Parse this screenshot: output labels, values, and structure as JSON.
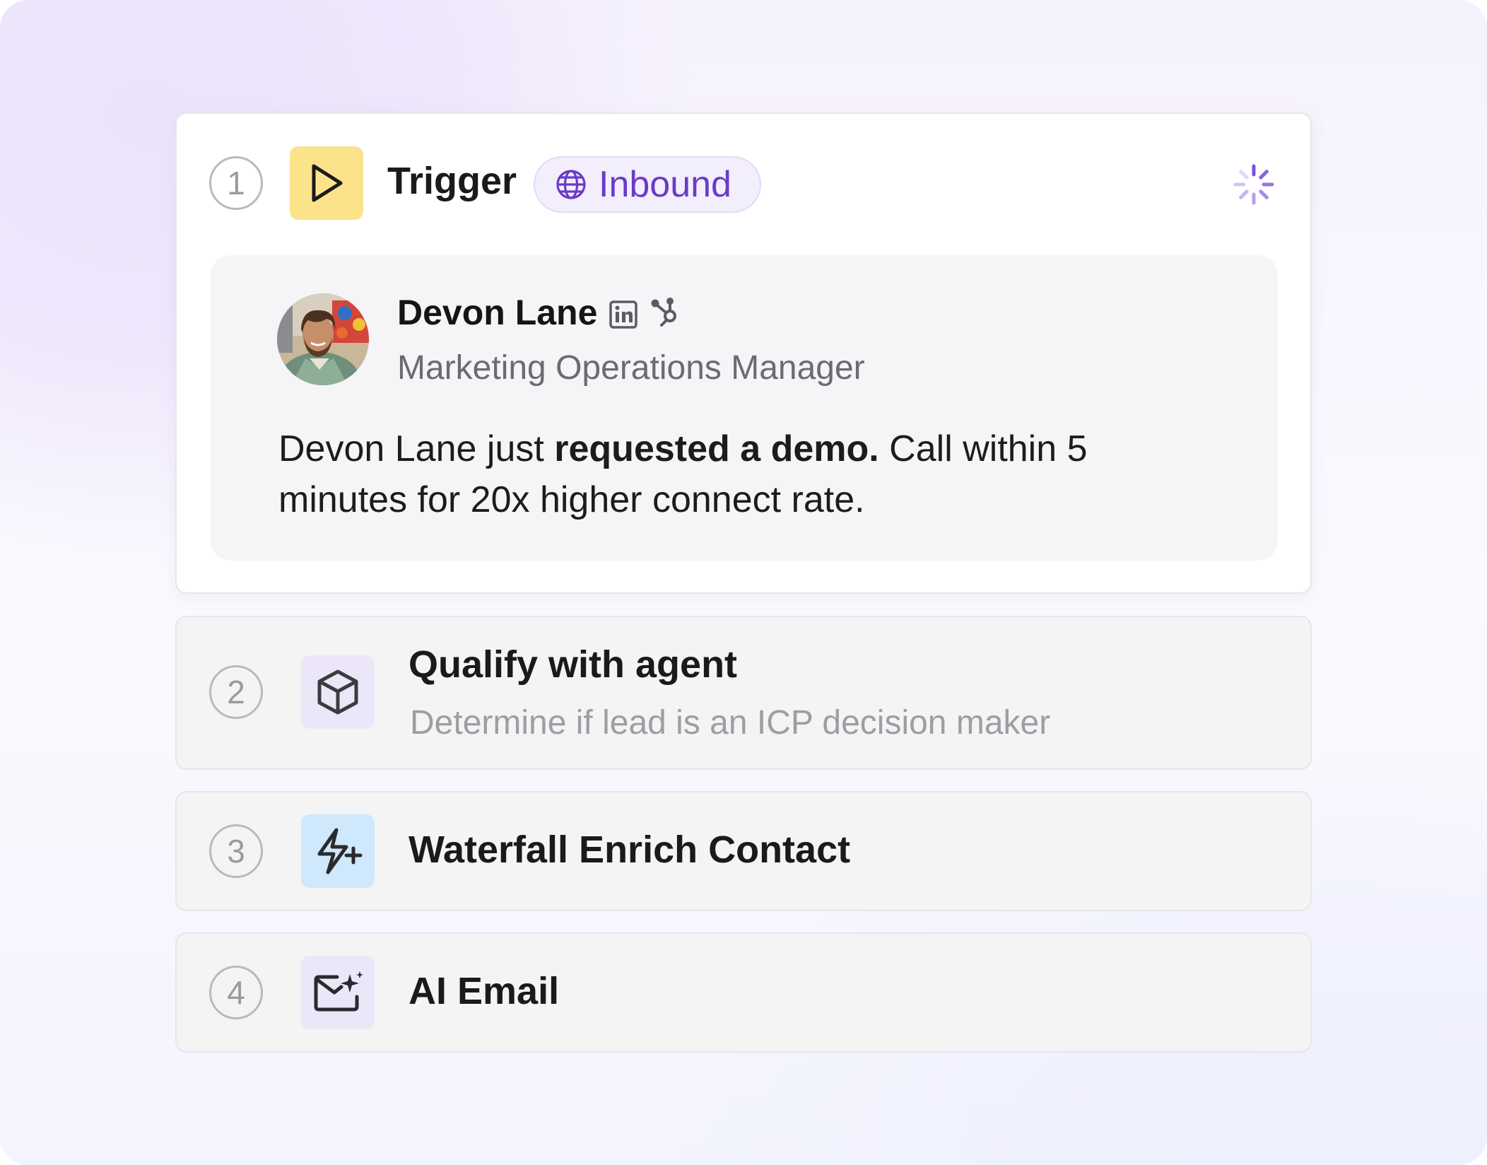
{
  "colors": {
    "accent_purple": "#6a3bc7",
    "trigger_tile": "#fbe38b",
    "agent_tile": "#ece7f8",
    "enrich_tile": "#cfe8fb",
    "email_tile": "#ece7f8"
  },
  "steps": [
    {
      "number": "1",
      "title": "Trigger",
      "icon": "play-icon",
      "badge": {
        "label": "Inbound",
        "icon": "globe-icon"
      },
      "status_icon": "loading-spinner-icon",
      "contact": {
        "name": "Devon Lane",
        "role": "Marketing Operations Manager",
        "icons": [
          "linkedin-icon",
          "hubspot-icon"
        ]
      },
      "message": {
        "before": "Devon Lane just ",
        "bold": "requested a demo.",
        "after": " Call within 5 minutes for 20x higher connect rate."
      }
    },
    {
      "number": "2",
      "title": "Qualify with agent",
      "subtitle": "Determine if lead is an ICP decision maker",
      "icon": "cube-icon"
    },
    {
      "number": "3",
      "title": "Waterfall Enrich Contact",
      "icon": "lightning-plus-icon"
    },
    {
      "number": "4",
      "title": "AI Email",
      "icon": "sparkle-mail-icon"
    }
  ]
}
